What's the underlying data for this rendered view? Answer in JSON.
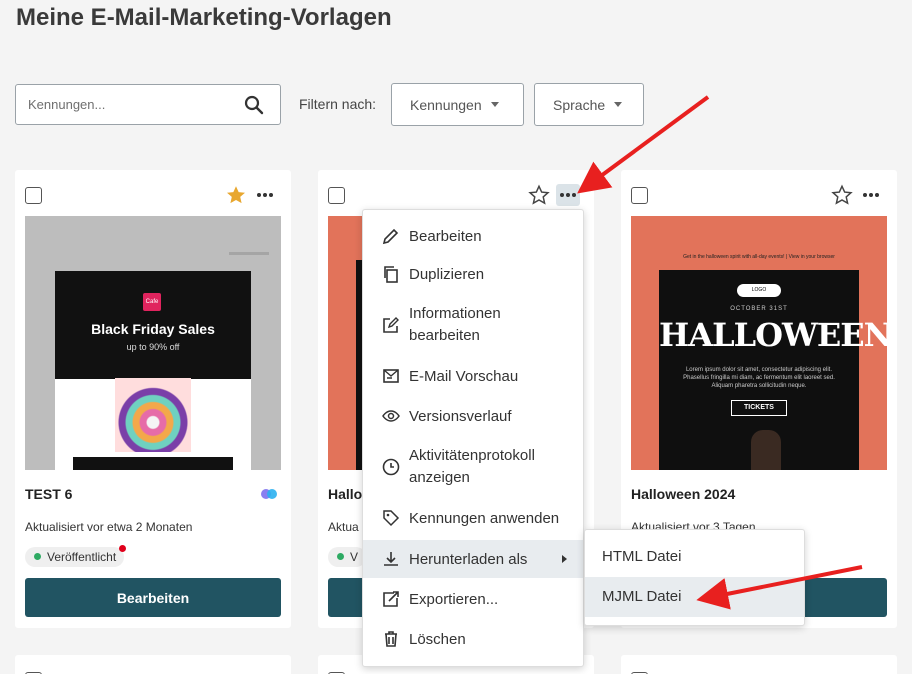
{
  "page": {
    "title": "Meine E-Mail-Marketing-Vorlagen"
  },
  "search": {
    "placeholder": "Kennungen..."
  },
  "filters": {
    "label": "Filtern nach:",
    "options": [
      "Kennungen",
      "Sprache"
    ]
  },
  "cards": [
    {
      "name": "TEST 6",
      "updated": "Aktualisiert vor etwa 2 Monaten",
      "status": "Veröffentlicht",
      "button": "Bearbeiten",
      "starred": true,
      "thumb": {
        "title": "Black Friday Sales",
        "subtitle": "up to 90% off",
        "logo_text": "Cafe"
      }
    },
    {
      "name": "Hallo",
      "updated": "Aktua",
      "status": "V",
      "button": "Bearbeiten",
      "starred": false
    },
    {
      "name": "Halloween 2024",
      "updated": "Aktualisiert vor 3 Tagen",
      "button": "Bearbeiten",
      "starred": false,
      "thumb": {
        "top_text": "Get in the halloween spirit with all-day events! | View in your browser",
        "logo": "LOGO",
        "date": "OCTOBER 31ST",
        "title": "HALLOWEEN",
        "body": "Lorem ipsum dolor sit amet, consectetur adipiscing elit. Phasellus fringilla mi diam, ac fermentum elit laoreet sed. Aliquam pharetra sollicitudin neque.",
        "cta": "TICKETS"
      }
    }
  ],
  "context_menu": {
    "items": [
      {
        "label": "Bearbeiten",
        "icon": "pencil-icon"
      },
      {
        "label": "Duplizieren",
        "icon": "copy-icon"
      },
      {
        "label": "Informationen bearbeiten",
        "icon": "edit-info-icon"
      },
      {
        "label": "E-Mail Vorschau",
        "icon": "mail-preview-icon"
      },
      {
        "label": "Versionsverlauf",
        "icon": "eye-icon"
      },
      {
        "label": "Aktivitätenprotokoll anzeigen",
        "icon": "clock-icon"
      },
      {
        "label": "Kennungen anwenden",
        "icon": "tag-icon"
      },
      {
        "label": "Herunterladen als",
        "icon": "download-icon"
      },
      {
        "label": "Exportieren...",
        "icon": "export-icon"
      },
      {
        "label": "Löschen",
        "icon": "trash-icon"
      }
    ]
  },
  "download_submenu": {
    "items": [
      "HTML Datei",
      "MJML Datei"
    ]
  },
  "colors": {
    "primary_button": "#215462",
    "star": "#e8a72f",
    "annotation_arrow": "#e8201f",
    "status_green": "#2eaa63"
  }
}
